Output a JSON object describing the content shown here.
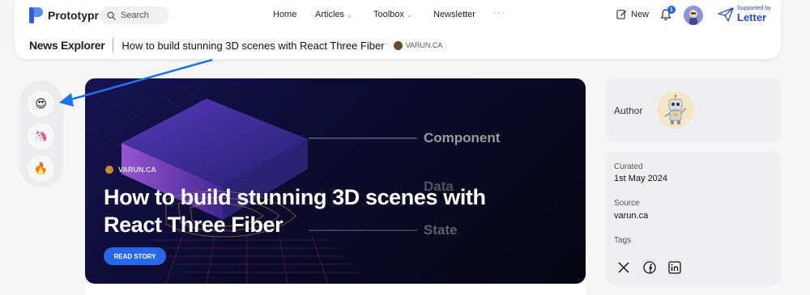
{
  "header": {
    "logo_text": "Prototypr",
    "search_placeholder": "Search",
    "nav": [
      {
        "label": "Home",
        "dropdown": false
      },
      {
        "label": "Articles",
        "dropdown": true
      },
      {
        "label": "Toolbox",
        "dropdown": true
      },
      {
        "label": "Newsletter",
        "dropdown": false
      }
    ],
    "more": "···",
    "new_label": "New",
    "notification_count": "1",
    "supported_small": "Supported by",
    "supported_big": "Letter"
  },
  "subheader": {
    "section": "News Explorer",
    "title": "How to build stunning 3D scenes with React Three Fiber",
    "source": "VARUN.CA"
  },
  "reactions": [
    {
      "icon": "heart-eyes-emoji-icon",
      "glyph": "😍"
    },
    {
      "icon": "unicorn-emoji-icon",
      "glyph": "🦄"
    },
    {
      "icon": "fire-emoji-icon",
      "glyph": "🔥"
    }
  ],
  "hero": {
    "labels": [
      "Component",
      "Data",
      "State"
    ],
    "source": "VARUN.CA",
    "title": "How to build stunning 3D scenes with React Three Fiber",
    "button": "READ STORY"
  },
  "sidebar": {
    "author_label": "Author",
    "curated_label": "Curated",
    "curated_value": "1st May 2024",
    "source_label": "Source",
    "source_value": "varun.ca",
    "tags_label": "Tags",
    "share_icons": [
      "x-icon",
      "facebook-icon",
      "linkedin-icon"
    ]
  },
  "colors": {
    "accent": "#2767e8",
    "annotation_arrow": "#1e73e8",
    "hero_bg": "#0c0b2e"
  }
}
